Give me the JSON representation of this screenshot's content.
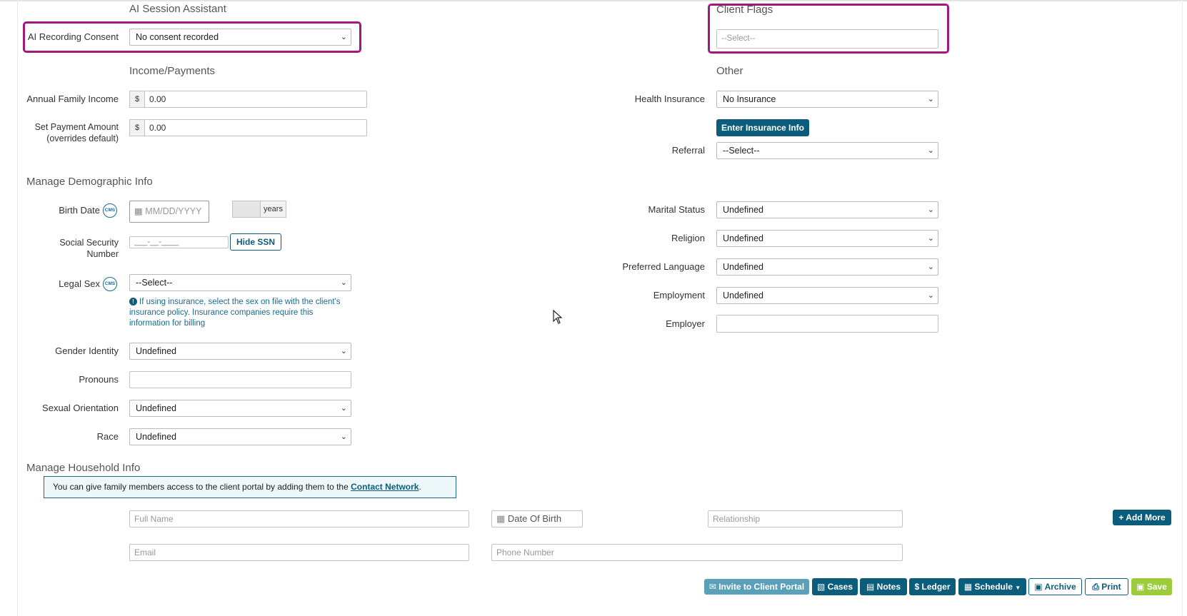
{
  "ai": {
    "section_title": "AI Session Assistant",
    "consent_label": "AI Recording Consent",
    "consent_value": "No consent recorded"
  },
  "client_flags": {
    "section_title": "Client Flags",
    "placeholder": "--Select--"
  },
  "income": {
    "section_title": "Income/Payments",
    "annual_label": "Annual Family Income",
    "annual_prefix": "$",
    "annual_value": "0.00",
    "payment_label_1": "Set Payment Amount",
    "payment_label_2": "(overrides default)",
    "payment_prefix": "$",
    "payment_value": "0.00"
  },
  "other": {
    "section_title": "Other",
    "health_label": "Health Insurance",
    "health_value": "No Insurance",
    "enter_insurance_button": "Enter Insurance Info",
    "referral_label": "Referral",
    "referral_value": "--Select--"
  },
  "demographic": {
    "section_title": "Manage Demographic Info",
    "birth_label": "Birth Date",
    "cms_badge": "CMS",
    "birth_placeholder": "MM/DD/YYYY",
    "years_addon": "years",
    "ssn_label_1": "Social Security",
    "ssn_label_2": "Number",
    "ssn_mask": "___-__-____",
    "hide_ssn_button": "Hide SSN",
    "legal_sex_label": "Legal Sex",
    "legal_sex_value": "--Select--",
    "legal_sex_info": "If using insurance, select the sex on file with the client's insurance policy. Insurance companies require this information for billing",
    "gender_label": "Gender Identity",
    "gender_value": "Undefined",
    "pronouns_label": "Pronouns",
    "orientation_label": "Sexual Orientation",
    "orientation_value": "Undefined",
    "race_label": "Race",
    "race_value": "Undefined",
    "marital_label": "Marital Status",
    "marital_value": "Undefined",
    "religion_label": "Religion",
    "religion_value": "Undefined",
    "language_label": "Preferred Language",
    "language_value": "Undefined",
    "employment_label": "Employment",
    "employment_value": "Undefined",
    "employer_label": "Employer"
  },
  "household": {
    "section_title": "Manage Household Info",
    "alert_text": "You can give family members access to the client portal by adding them to the ",
    "alert_link": "Contact Network",
    "alert_end": ".",
    "full_name_placeholder": "Full Name",
    "dob_placeholder": "Date Of Birth",
    "relationship_placeholder": "Relationship",
    "add_more_button": "Add More",
    "email_placeholder": "Email",
    "phone_placeholder": "Phone Number"
  },
  "footer": {
    "invite": "Invite to Client Portal",
    "cases": "Cases",
    "notes": "Notes",
    "ledger": "Ledger",
    "schedule": "Schedule",
    "archive": "Archive",
    "print": "Print",
    "save": "Save"
  },
  "colors": {
    "highlight": "#a3187d",
    "primary": "#0c5c7c",
    "save": "#9ccc3c"
  }
}
